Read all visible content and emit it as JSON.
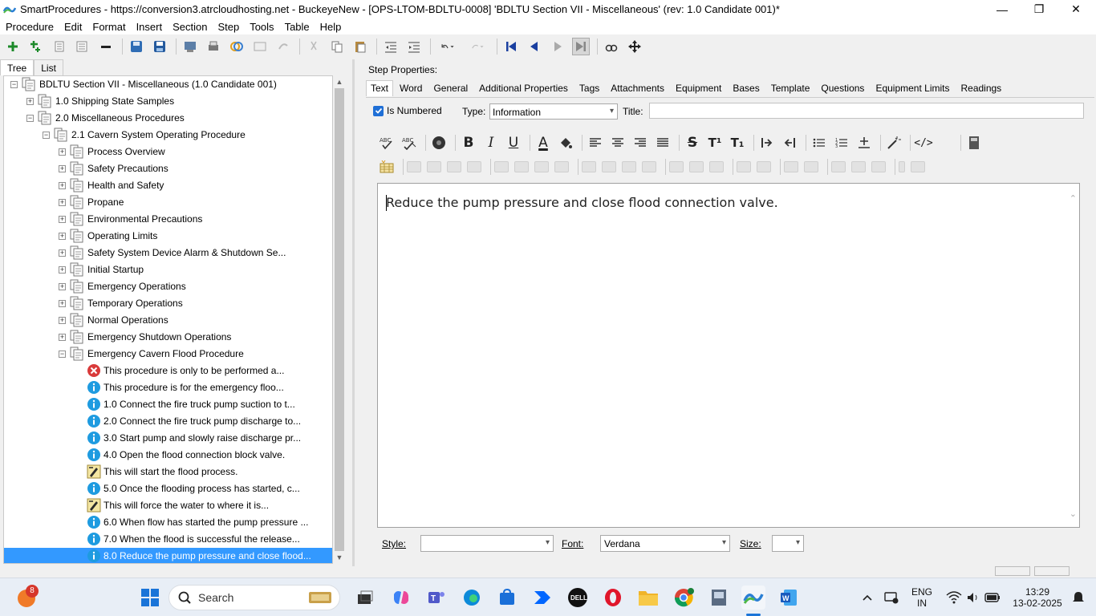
{
  "window": {
    "title": "SmartProcedures - https://conversion3.atrcloudhosting.net - BuckeyeNew - [OPS-LTOM-BDLTU-0008] 'BDLTU Section VII - Miscellaneous' (rev: 1.0 Candidate 001)*",
    "minimize": "—",
    "maximize": "❐",
    "close": "✕"
  },
  "menu": [
    "Procedure",
    "Edit",
    "Format",
    "Insert",
    "Section",
    "Step",
    "Tools",
    "Table",
    "Help"
  ],
  "left_tabs": [
    "Tree",
    "List"
  ],
  "tree": [
    {
      "label": "BDLTU Section VII - Miscellaneous (1.0 Candidate 001)",
      "level": 0,
      "expander": "−",
      "icon": "doc-icon"
    },
    {
      "label": "1.0 Shipping State Samples",
      "level": 1,
      "expander": "+",
      "icon": "doc-icon"
    },
    {
      "label": "2.0 Miscellaneous Procedures",
      "level": 1,
      "expander": "−",
      "icon": "doc-icon"
    },
    {
      "label": "2.1 Cavern System Operating Procedure",
      "level": 2,
      "expander": "−",
      "icon": "doc-icon"
    },
    {
      "label": "Process Overview",
      "level": 3,
      "expander": "+",
      "icon": "doc-icon"
    },
    {
      "label": "Safety Precautions",
      "level": 3,
      "expander": "+",
      "icon": "doc-icon"
    },
    {
      "label": "Health and Safety",
      "level": 3,
      "expander": "+",
      "icon": "doc-icon"
    },
    {
      "label": "Propane",
      "level": 3,
      "expander": "+",
      "icon": "doc-icon"
    },
    {
      "label": "Environmental Precautions",
      "level": 3,
      "expander": "+",
      "icon": "doc-icon"
    },
    {
      "label": "Operating Limits",
      "level": 3,
      "expander": "+",
      "icon": "doc-icon"
    },
    {
      "label": "Safety System Device Alarm & Shutdown Se...",
      "level": 3,
      "expander": "+",
      "icon": "doc-icon"
    },
    {
      "label": "Initial Startup",
      "level": 3,
      "expander": "+",
      "icon": "doc-icon"
    },
    {
      "label": "Emergency Operations",
      "level": 3,
      "expander": "+",
      "icon": "doc-icon"
    },
    {
      "label": "Temporary Operations",
      "level": 3,
      "expander": "+",
      "icon": "doc-icon"
    },
    {
      "label": "Normal Operations",
      "level": 3,
      "expander": "+",
      "icon": "doc-icon"
    },
    {
      "label": "Emergency Shutdown Operations",
      "level": 3,
      "expander": "+",
      "icon": "doc-icon"
    },
    {
      "label": "Emergency Cavern Flood Procedure",
      "level": 3,
      "expander": "−",
      "icon": "doc-icon"
    },
    {
      "label": "This procedure is only to be performed a...",
      "level": 4,
      "expander": "",
      "icon": "warning-icon"
    },
    {
      "label": "This procedure is for the emergency floo...",
      "level": 4,
      "expander": "",
      "icon": "info-icon"
    },
    {
      "label": "1.0 Connect the fire truck pump suction to t...",
      "level": 4,
      "expander": "",
      "icon": "info-icon"
    },
    {
      "label": "2.0 Connect the fire truck pump discharge to...",
      "level": 4,
      "expander": "",
      "icon": "info-icon"
    },
    {
      "label": "3.0 Start pump and slowly raise discharge pr...",
      "level": 4,
      "expander": "",
      "icon": "info-icon"
    },
    {
      "label": "4.0 Open the flood connection block valve.",
      "level": 4,
      "expander": "",
      "icon": "info-icon"
    },
    {
      "label": "This will start the flood process.",
      "level": 4,
      "expander": "",
      "icon": "note-icon"
    },
    {
      "label": "5.0 Once the flooding process has started, c...",
      "level": 4,
      "expander": "",
      "icon": "info-icon"
    },
    {
      "label": "This will force the water to where it is...",
      "level": 4,
      "expander": "",
      "icon": "note-icon"
    },
    {
      "label": "6.0 When flow has started the pump pressure ...",
      "level": 4,
      "expander": "",
      "icon": "info-icon"
    },
    {
      "label": "7.0 When the flood is successful the release...",
      "level": 4,
      "expander": "",
      "icon": "info-icon"
    },
    {
      "label": "8.0 Reduce the pump pressure and close flood...",
      "level": 4,
      "expander": "",
      "icon": "info-icon",
      "selected": true
    }
  ],
  "step_properties": {
    "label": "Step Properties:",
    "tabs": [
      "Text",
      "Word",
      "General",
      "Additional Properties",
      "Tags",
      "Attachments",
      "Equipment",
      "Bases",
      "Template",
      "Questions",
      "Equipment Limits",
      "Readings"
    ],
    "active_tab": "Text",
    "is_numbered_label": "Is Numbered",
    "is_numbered": true,
    "type_label": "Type:",
    "type_value": "Information",
    "title_label": "Title:",
    "title_value": ""
  },
  "format_buttons": {
    "bold": "B",
    "italic": "I",
    "underline": "U",
    "font_color": "A",
    "strike": "S",
    "superscript": "T¹",
    "subscript": "T₁",
    "html": "</>"
  },
  "editor": {
    "text": "Reduce the pump pressure and close flood connection valve."
  },
  "bottom": {
    "style_label": "Style:",
    "style_value": "",
    "font_label": "Font:",
    "font_value": "Verdana",
    "size_label": "Size:",
    "size_value": ""
  },
  "taskbar": {
    "search_placeholder": "Search",
    "notification_count": "8",
    "language_line1": "ENG",
    "language_line2": "IN",
    "time": "13:29",
    "date": "13-02-2025"
  },
  "colors": {
    "selection": "#3399ff",
    "info_icon": "#1e9be0",
    "warning_icon": "#d93a3a",
    "checkbox": "#1f6fd6",
    "taskbar": "#e8eef6"
  }
}
